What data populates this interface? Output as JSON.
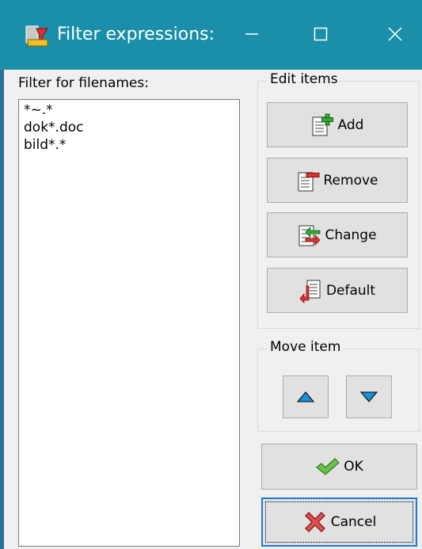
{
  "window": {
    "title": "Filter expressions:"
  },
  "filter_list": {
    "label": "Filter for filenames:",
    "items": [
      "*~.*",
      "dok*.doc",
      "bild*.*"
    ]
  },
  "edit_items": {
    "label": "Edit items",
    "add": "Add",
    "remove": "Remove",
    "change": "Change",
    "default": "Default"
  },
  "move_item": {
    "label": "Move item"
  },
  "footer": {
    "ok": "OK",
    "cancel": "Cancel"
  }
}
